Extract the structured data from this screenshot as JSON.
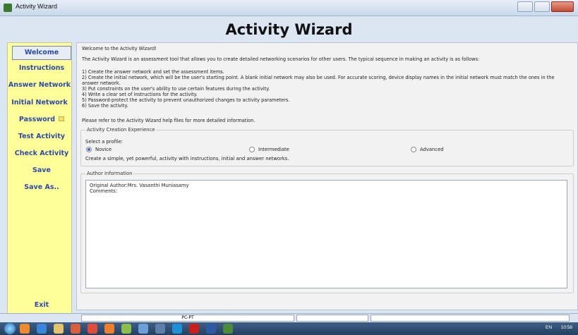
{
  "window": {
    "title": "Activity Wizard"
  },
  "header": {
    "title": "Activity Wizard"
  },
  "sidebar": {
    "items": [
      {
        "label": "Welcome",
        "active": true
      },
      {
        "label": "Instructions"
      },
      {
        "label": "Answer Network"
      },
      {
        "label": "Initial Network"
      },
      {
        "label": "Password",
        "icon": "lock-icon"
      },
      {
        "label": "Test Activity"
      },
      {
        "label": "Check Activity"
      },
      {
        "label": "Save"
      },
      {
        "label": "Save As.."
      },
      {
        "label": "Exit"
      }
    ]
  },
  "main": {
    "welcome": "Welcome to the Activity Wizard!",
    "intro": "The Activity Wizard is an assessment tool that allows you to create detailed networking scenarios for other users. The typical sequence in making an activity is as follows:",
    "steps": [
      "1) Create the answer network and set the assessment items.",
      "2) Create the initial network, which will be the user's starting point. A blank initial network may also be used. For accurate scoring, device display names in the initial network must match the ones in the",
      "answer network.",
      "3) Put constraints on the user's ability to use certain features during the activity.",
      "4) Write a clear set of instructions for the activity.",
      "5) Password-protect the activity to prevent unauthorized changes to activity parameters.",
      "6) Save the activity."
    ],
    "help": "Please refer to the Activity Wizard help files for more detailed information.",
    "experience": {
      "legend": "Activity Creation Experience",
      "prompt": "Select a profile:",
      "options": [
        "Novice",
        "Intermediate",
        "Advanced"
      ],
      "selected": "Novice",
      "description": "Create a simple, yet powerful, activity with instructions, initial and answer networks."
    },
    "author": {
      "legend": "Author Information",
      "line1": "Original Author:Mrs. Vasanthi Muniasamy",
      "line2": "Comments:"
    }
  },
  "statusbar": {
    "field": "PC-PT"
  },
  "taskbar": {
    "lang": "EN",
    "time": "10:58"
  }
}
